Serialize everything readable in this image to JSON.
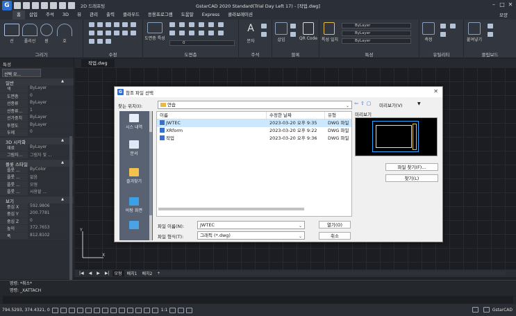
{
  "app": {
    "title": "GstarCAD 2020 Standard(Trial Day Left 17) - [작업.dwg]",
    "logo_letter": "G",
    "workspace": "2D 드래프팅",
    "user": "모양"
  },
  "menu": [
    "홈",
    "삽입",
    "주석",
    "3D",
    "뷰",
    "관리",
    "출력",
    "클라우드",
    "응용프로그램",
    "도움말",
    "Express",
    "콜라보레이션"
  ],
  "ribbon": {
    "panels": [
      "그리기",
      "수정",
      "도면층",
      "주석",
      "블록",
      "특성",
      "유틸리티",
      "클립보드"
    ],
    "labels": {
      "line": "선",
      "polyline": "폴리선",
      "circle": "원",
      "arc": "호",
      "layer_props": "도면층 특성",
      "text": "문자",
      "insert": "삽입",
      "qr": "QR Code",
      "match": "특성 일치",
      "measure": "측정",
      "paste": "붙여넣기"
    },
    "bylayer": [
      "ByLayer",
      "ByLayer",
      "ByLayer"
    ]
  },
  "properties": {
    "title": "특성",
    "selection": "선택 요...",
    "sections": [
      {
        "name": "일반",
        "rows": [
          [
            "색",
            "ByLayer"
          ],
          [
            "도면층",
            "0"
          ],
          [
            "선종류",
            "ByLayer"
          ],
          [
            "선종류...",
            "1"
          ],
          [
            "선가중치",
            "ByLayer"
          ],
          [
            "투명도",
            "ByLayer"
          ],
          [
            "두께",
            "0"
          ]
        ]
      },
      {
        "name": "3D 시각화",
        "rows": [
          [
            "재료",
            "ByLayer"
          ],
          [
            "그림자...",
            "그림자 및 ..."
          ]
        ]
      },
      {
        "name": "플롯 스타일",
        "rows": [
          [
            "플롯 ...",
            "ByColor"
          ],
          [
            "플롯 ...",
            "없음"
          ],
          [
            "플롯 ...",
            "모형"
          ],
          [
            "플롯 ...",
            "사용할 ..."
          ]
        ]
      },
      {
        "name": "보기",
        "rows": [
          [
            "중심 X",
            "592.9806"
          ],
          [
            "중심 Y",
            "200.7781"
          ],
          [
            "중심 Z",
            "0"
          ],
          [
            "높이",
            "372.7653"
          ],
          [
            "폭",
            "812.8102"
          ]
        ]
      }
    ]
  },
  "document": {
    "tab": "작업.dwg",
    "layout_tabs": [
      "모형",
      "배치1",
      "배치2",
      "+"
    ]
  },
  "command": {
    "lines": [
      "명령: *취소*",
      "명령: _XATTACH"
    ]
  },
  "status": {
    "coords": "794.5293, 374.4321, 0",
    "scale": "1:1",
    "brand": "GstarCAD"
  },
  "dialog": {
    "title": "참조 파일 선택",
    "look_in_label": "찾는 위치(I):",
    "look_in_value": "연습",
    "views_label": "미리보기(V)",
    "views_arrow": "▼",
    "columns": [
      "이름",
      "수정한 날짜",
      "유형"
    ],
    "files": [
      {
        "name": "JWTEC",
        "date": "2023-03-20 오후 9:35",
        "type": "DWG 파일"
      },
      {
        "name": "XRform",
        "date": "2023-03-20 오후 9:22",
        "type": "DWG 파일"
      },
      {
        "name": "작업",
        "date": "2023-03-20 오후 9:36",
        "type": "DWG 파일"
      }
    ],
    "places": [
      "시스 내역",
      "문서",
      "즐겨찾기",
      "바탕 화면"
    ],
    "preview_label": "미리보기",
    "find_file_button": "파일 찾기(F)...",
    "find_button": "찾기(L)",
    "file_name_label": "파일 이름(N):",
    "file_name_value": "JWTEC",
    "file_type_label": "파일 형식(T):",
    "file_type_value": "그래픽 (*.dwg)",
    "open_button": "열기(O)",
    "cancel_button": "취소"
  }
}
